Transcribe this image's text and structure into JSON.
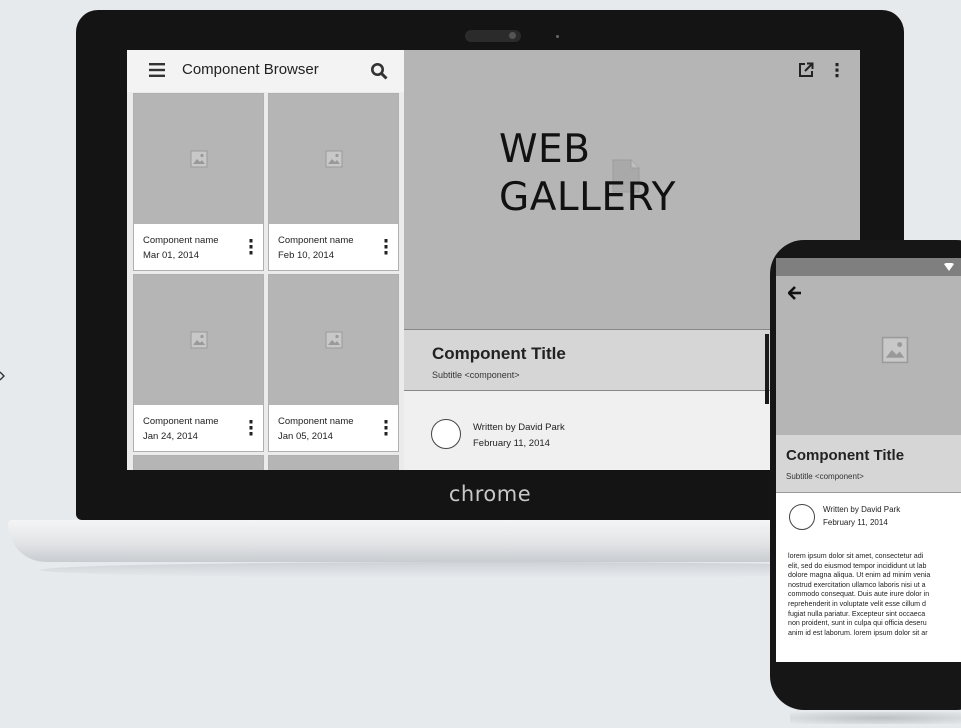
{
  "laptop": {
    "brand": "chrome",
    "app": {
      "title": "Component Browser",
      "cards": [
        {
          "name": "Component name",
          "date": "Mar 01, 2014"
        },
        {
          "name": "Component name",
          "date": "Feb 10, 2014"
        },
        {
          "name": "Component name",
          "date": "Jan 24, 2014"
        },
        {
          "name": "Component name",
          "date": "Jan 05, 2014"
        }
      ],
      "hero_title_line1": "WEB",
      "hero_title_line2": "GALLERY",
      "component_title": "Component Title",
      "component_subtitle": "Subtitle <component>",
      "author": "Written by David Park",
      "date": "February 11, 2014"
    }
  },
  "phone": {
    "component_title": "Component Title",
    "component_subtitle": "Subtitle <component>",
    "author": "Written by David Park",
    "date": "February 11, 2014",
    "body": "lorem ipsum dolor sit amet, consectetur adi\nelit, sed do eiusmod tempor incididunt ut lab\ndolore magna aliqua. Ut enim ad minim venia\nnostrud exercitation ullamco laboris nisi ut a\ncommodo consequat. Duis aute irure dolor in\nreprehenderit in voluptate velit esse cillum d\nfugiat nulla pariatur. Excepteur sint occaeca\nnon proident, sunt in culpa qui officia deseru\nanim id est laborum. lorem ipsum dolor sit ar"
  },
  "icons": [
    "menu-icon",
    "search-icon",
    "image-placeholder-icon",
    "more-vert-icon",
    "open-in-new-icon",
    "document-icon",
    "back-arrow-icon",
    "wifi-icon",
    "chevron-right-icon"
  ],
  "colors": {
    "background": "#e6eaed",
    "placeholder": "#b5b5b5",
    "device": "#141414"
  }
}
